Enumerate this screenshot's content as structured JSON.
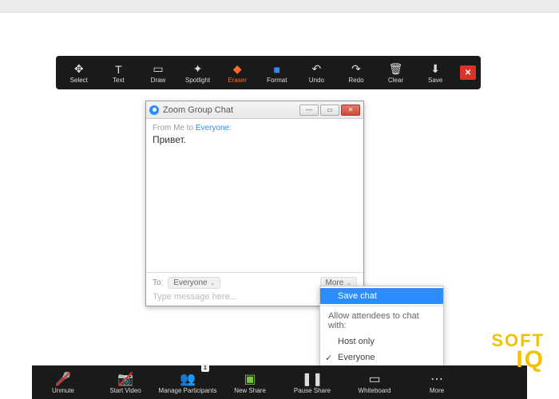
{
  "annotation": {
    "items": [
      {
        "name": "select",
        "label": "Select",
        "icon": "✥"
      },
      {
        "name": "text",
        "label": "Text",
        "icon": "T"
      },
      {
        "name": "draw",
        "label": "Draw",
        "icon": "▭"
      },
      {
        "name": "spotlight",
        "label": "Spotlight",
        "icon": "✦"
      },
      {
        "name": "eraser",
        "label": "Eraser",
        "icon": "◆",
        "active": true
      },
      {
        "name": "format",
        "label": "Format",
        "icon": "■"
      },
      {
        "name": "undo",
        "label": "Undo",
        "icon": "↶"
      },
      {
        "name": "redo",
        "label": "Redo",
        "icon": "↷"
      },
      {
        "name": "clear",
        "label": "Clear",
        "icon": "🗑"
      },
      {
        "name": "save",
        "label": "Save",
        "icon": "⬇"
      }
    ],
    "close_icon": "✕"
  },
  "chat": {
    "title": "Zoom Group Chat",
    "from_prefix": "From Me to ",
    "from_target": "Everyone",
    "from_suffix": ":",
    "message": "Привет.",
    "to_label": "To:",
    "to_target": "Everyone",
    "more_label": "More",
    "input_placeholder": "Type message here..."
  },
  "more_menu": {
    "save_chat": "Save chat",
    "section_label": "Allow attendees to chat with:",
    "host_only": "Host only",
    "everyone": "Everyone"
  },
  "meeting": {
    "items": [
      {
        "name": "unmute",
        "label": "Unmute",
        "icon": "🎤",
        "slashed": true
      },
      {
        "name": "start-video",
        "label": "Start Video",
        "icon": "📷",
        "slashed": true
      },
      {
        "name": "manage-participants",
        "label": "Manage Participants",
        "icon": "👥",
        "badge": "1"
      },
      {
        "name": "new-share",
        "label": "New Share",
        "icon": "▣",
        "green": true
      },
      {
        "name": "pause-share",
        "label": "Pause Share",
        "icon": "❚❚"
      },
      {
        "name": "whiteboard",
        "label": "Whiteboard",
        "icon": "▭"
      },
      {
        "name": "more",
        "label": "More",
        "icon": "⋯"
      }
    ]
  },
  "logo": {
    "line1": "SOFT",
    "line2": "IQ"
  }
}
